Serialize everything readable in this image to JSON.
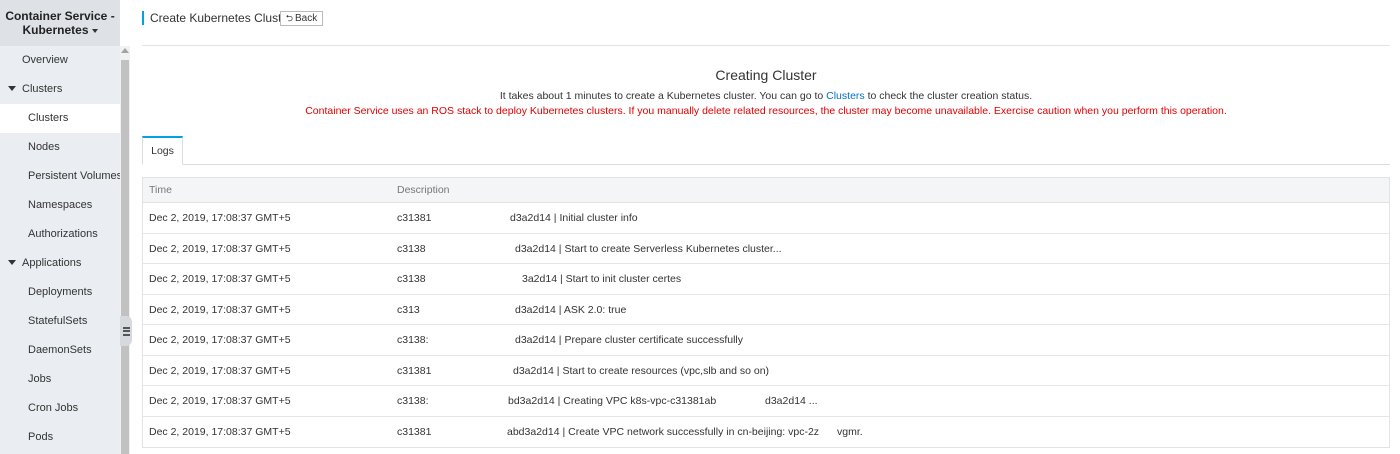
{
  "sidebar": {
    "title_line1": "Container Service -",
    "title_line2": "Kubernetes",
    "overview": "Overview",
    "groups": [
      {
        "label": "Clusters",
        "items": [
          "Clusters",
          "Nodes",
          "Persistent Volumes",
          "Namespaces",
          "Authorizations"
        ]
      },
      {
        "label": "Applications",
        "items": [
          "Deployments",
          "StatefulSets",
          "DaemonSets",
          "Jobs",
          "Cron Jobs",
          "Pods"
        ]
      }
    ],
    "active_item": "Clusters"
  },
  "topbar": {
    "title": "Create Kubernetes Cluster",
    "back_label": "Back"
  },
  "status": {
    "heading": "Creating Cluster",
    "info_before": "It takes about 1 minutes to create a Kubernetes cluster. You can go to ",
    "info_link": "Clusters",
    "info_after": " to check the cluster creation status.",
    "warning": "Container Service uses an ROS stack to deploy Kubernetes clusters. If you manually delete related resources, the cluster may become unavailable. Exercise caution when you perform this operation."
  },
  "tabs": [
    {
      "label": "Logs",
      "active": true
    }
  ],
  "logs": {
    "columns": [
      "Time",
      "Description"
    ],
    "rows": [
      {
        "time": "Dec 2, 2019, 17:08:37 GMT+5",
        "id": "c31381",
        "msg": "d3a2d14 | Initial cluster info"
      },
      {
        "time": "Dec 2, 2019, 17:08:37 GMT+5",
        "id": "c3138",
        "msg": "d3a2d14 | Start to create Serverless Kubernetes cluster..."
      },
      {
        "time": "Dec 2, 2019, 17:08:37 GMT+5",
        "id": "c3138",
        "msg": "3a2d14 | Start to init cluster certes"
      },
      {
        "time": "Dec 2, 2019, 17:08:37 GMT+5",
        "id": "c313",
        "msg": "d3a2d14 | ASK 2.0: true"
      },
      {
        "time": "Dec 2, 2019, 17:08:37 GMT+5",
        "id": "c3138:",
        "msg": "d3a2d14 | Prepare cluster certificate successfully"
      },
      {
        "time": "Dec 2, 2019, 17:08:37 GMT+5",
        "id": "c31381",
        "msg": "d3a2d14 | Start to create resources (vpc,slb and so on)"
      },
      {
        "time": "Dec 2, 2019, 17:08:37 GMT+5",
        "id": "c3138:",
        "msg": "bd3a2d14 | Creating VPC k8s-vpc-c31381ab",
        "tail": "d3a2d14 ..."
      },
      {
        "time": "Dec 2, 2019, 17:08:37 GMT+5",
        "id": "c31381",
        "msg": "abd3a2d14 | Create VPC network successfully in cn-beijing: vpc-2z",
        "tail": "vgmr."
      }
    ]
  }
}
